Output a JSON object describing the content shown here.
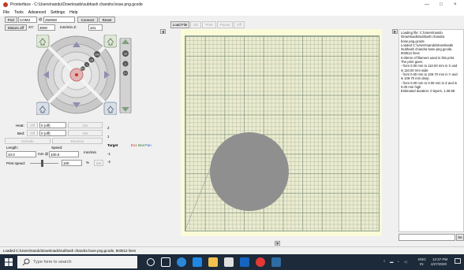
{
  "window": {
    "title": "Pronterface - C:\\Users\\nandu\\Downloads\\subhash chandra bose.png.gcode",
    "minimize": "—",
    "maximize": "□",
    "close": "×"
  },
  "menu": [
    "File",
    "Tools",
    "Advanced",
    "Settings",
    "Help"
  ],
  "connection": {
    "port_label": "Port",
    "port_value": "COM3",
    "at_label": "@",
    "baud_value": "250000",
    "connect": "Connect",
    "reset": "Reset"
  },
  "motors": {
    "motors_off": "Motors off",
    "xy_label": "XY:",
    "xy_value": "3000",
    "mm_min_label": "mm/min Z:",
    "z_value": "101"
  },
  "jog": {
    "ring_labels": [
      "100",
      "10",
      "1",
      "0.1"
    ],
    "z_buttons": [
      "10",
      "1",
      "0.1"
    ]
  },
  "temperature": {
    "heat_label": "Heat:",
    "off": "Off",
    "heat_value": "0 (off)",
    "set": "Set",
    "bed_label": "Bed:",
    "bed_value": "0 (off)"
  },
  "extrude": {
    "extrude": "Extrude",
    "reverse": "Reverse",
    "length_label": "Length:",
    "length_value": "10.0",
    "mm_at": "mm @",
    "speed_label": "Speed:",
    "speed_value": "100.0",
    "mm_min": "mm/min",
    "print_speed_label": "Print speed:",
    "print_speed_value": "100",
    "percent": "%",
    "set": "Set"
  },
  "graph": {
    "labels": [
      "2",
      "1",
      "-1",
      "-2"
    ],
    "legend": [
      "Target",
      "Ex1",
      "Bed",
      "Fan"
    ],
    "legend_colors": [
      "#000000",
      "#c0392b",
      "#2e7d32",
      "#1565c0"
    ]
  },
  "toolbar": {
    "load_file": "Load File",
    "sd": "SD",
    "print": "Print",
    "pause": "Pause",
    "off": "Off"
  },
  "log": [
    "Loading file: C:\\Users\\nandu",
    "\\Downloads\\subhash chandra",
    "bose.png.gcode",
    "Loaded C:\\Users\\nandu\\Downloads",
    "\\subhash chandra bose.png.gcode,",
    "503512 lines",
    "0.00mm of filament used in this print",
    "The print goes:",
    "- from 0.00 mm to 110.00 mm in X and",
    "is 110.00 mm wide",
    "- from 0.00 mm to 109.70 mm in Y and",
    "is 109.70 mm deep",
    "- from 0.00 mm to 0.00 mm in Z and is",
    "0.00 mm high",
    "Estimated duration: 0 layers, 1:26:58"
  ],
  "log_send": "Se",
  "status": "Loaded C:\\Users\\nandu\\Downloads\\subhash chandra bose.png.gcode, 503512 lines",
  "taskbar": {
    "search_placeholder": "Type here to search",
    "lang": "ENG",
    "region": "IN",
    "time": "12:37 PM",
    "date": "4/27/2020"
  }
}
